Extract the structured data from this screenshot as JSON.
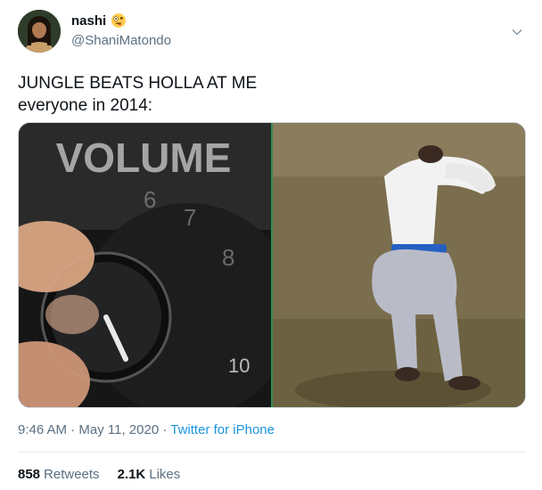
{
  "user": {
    "display_name": "nashi",
    "handle": "@ShaniMatondo",
    "name_emoji": "zany-face-emoji"
  },
  "tweet": {
    "lines": [
      "JUNGLE BEATS HOLLA AT ME",
      "everyone in 2014:"
    ]
  },
  "media": {
    "left_panel": {
      "description_icon": "volume-knob-image",
      "knob_text_top": "VOLUME",
      "knob_text_bottom": "10"
    },
    "right_panel": {
      "description_icon": "man-dancing-image"
    }
  },
  "meta": {
    "time": "9:46 AM",
    "separator": "·",
    "date": "May 11, 2020",
    "source": "Twitter for iPhone"
  },
  "stats": {
    "retweets_count": "858",
    "retweets_label": "Retweets",
    "likes_count": "2.1K",
    "likes_label": "Likes"
  },
  "colors": {
    "link": "#1b95e0",
    "secondary_text": "#5b7083",
    "primary_text": "#0f1419"
  }
}
